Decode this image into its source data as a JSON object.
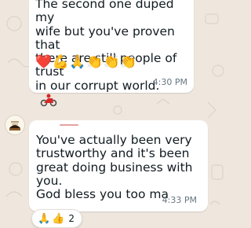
{
  "messages": [
    {
      "text_lines": [
        "The second one duped my",
        "wife but you've proven that",
        "there are still people of trust",
        "in our corrupt world."
      ],
      "emojis": "❤️💪🙏👏👏👏",
      "time": "4:30 PM"
    },
    {
      "text_lines": [
        "You've actually been very",
        "trustworthy and it's been",
        "great doing business with",
        "you.",
        "God bless you too ma"
      ],
      "time": "4:33 PM",
      "reactions": {
        "emojis": [
          "🙏",
          "👍"
        ],
        "count": "2"
      }
    }
  ],
  "colors": {
    "chat_background": "#efe7de",
    "bubble": "#ffffff",
    "timestamp": "#667781"
  }
}
